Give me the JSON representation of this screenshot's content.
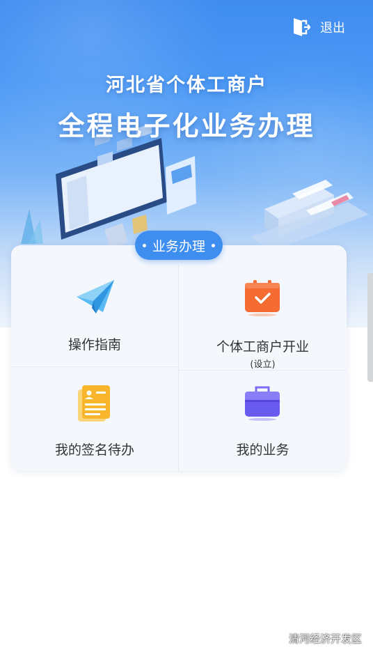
{
  "header": {
    "logout_label": "退出",
    "title_line1": "河北省个体工商户",
    "title_line2": "全程电子化业务办理"
  },
  "section": {
    "badge_label": "业务办理"
  },
  "menu": {
    "items": [
      {
        "label": "操作指南",
        "icon": "paper-plane-icon"
      },
      {
        "label": "个体工商户开业",
        "sublabel": "(设立)",
        "icon": "briefcase-check-icon"
      },
      {
        "label": "我的签名待办",
        "icon": "document-icon"
      },
      {
        "label": "我的业务",
        "icon": "toolbox-icon"
      }
    ]
  },
  "watermark": {
    "text": "清河经济开发区",
    "icon": "wechat-icon"
  },
  "colors": {
    "primary": "#3e8ef0",
    "hero_top": "#3f8cf0",
    "orange": "#f56b32",
    "yellow": "#f9b52b",
    "purple": "#6a5bf0"
  }
}
